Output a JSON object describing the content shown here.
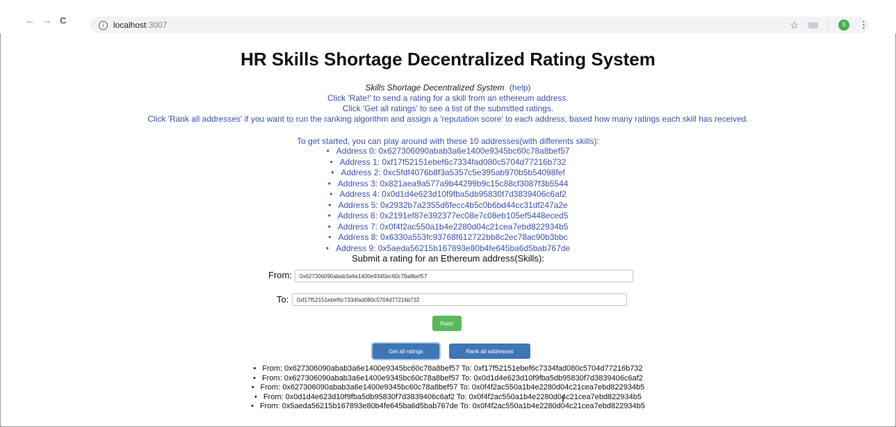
{
  "browser": {
    "url_host": "localhost",
    "url_port": ":3007",
    "back_glyph": "←",
    "forward_glyph": "→",
    "reload_glyph": "C",
    "info_glyph": "i",
    "star_glyph": "☆",
    "profile_initial": "S",
    "menu_glyph": "⋮"
  },
  "page": {
    "title": "HR Skills Shortage Decentralized Rating System",
    "system_name": "Skills Shortage Decentralized System",
    "help_link": "(help)",
    "intro_lines": [
      "Click 'Rate!' to send a rating for a skill from an ethereum address.",
      "Click 'Get all ratings' to see a list of the submitted ratings.",
      "Click 'Rank all addresses' if you want to run the ranking algorithm and assign a 'reputation score' to each address, based how many ratings each skill has received."
    ],
    "started_text": "To get started, you can play around with these 10 addresses(with differents skills):",
    "addresses": [
      "Address 0: 0x627306090abab3a6e1400e9345bc60c78a8bef57",
      "Address 1: 0xf17f52151ebef6c7334fad080c5704d77216b732",
      "Address 2: 0xc5fdf4076b8f3a5357c5e395ab970b5b54098fef",
      "Address 3: 0x821aea9a577a9b44299b9c15c88cf3087f3b5544",
      "Address 4: 0x0d1d4e623d10f9fba5db95830f7d3839406c6af2",
      "Address 5: 0x2932b7a2355d6fecc4b5c0b6bd44cc31df247a2e",
      "Address 6: 0x2191ef87e392377ec08e7c08eb105ef5448eced5",
      "Address 7: 0x0f4f2ac550a1b4e2280d04c21cea7ebd822934b5",
      "Address 8: 0x6330a553fc93768f612722bb8c2ec78ac90b3bbc",
      "Address 9: 0x5aeda56215b167893e80b4fe645ba6d5bab767de"
    ],
    "submit_heading": "Submit a rating for an Ethereum address(Skills):",
    "form": {
      "from_label": "From:",
      "from_value": "0x627306090abab3a6e1400e9345bc60c78a8bef57",
      "to_label": "To:",
      "to_value": "0xf17f52151ebef6c7334fad080c5704d77216b732",
      "rate_label": "Rate!",
      "get_all_label": "Get all ratings",
      "rank_all_label": "Rank all addresses"
    },
    "ratings": [
      "From: 0x627306090abab3a6e1400e9345bc60c78a8bef57 To: 0xf17f52151ebef6c7334fad080c5704d77216b732",
      "From: 0x627306090abab3a6e1400e9345bc60c78a8bef57 To: 0x0d1d4e623d10f9fba5db95830f7d3839406c6af2",
      "From: 0x627306090abab3a6e1400e9345bc60c78a8bef57 To: 0x0f4f2ac550a1b4e2280d04c21cea7ebd822934b5",
      "From: 0x0d1d4e623d10f9fba5db95830f7d3839406c6af2 To: 0x0f4f2ac550a1b4e2280d04c21cea7ebd822934b5",
      "From: 0x5aeda56215b167893e80b4fe645ba6d5bab767de To: 0x0f4f2ac550a1b4e2280d04c21cea7ebd822934b5"
    ]
  }
}
